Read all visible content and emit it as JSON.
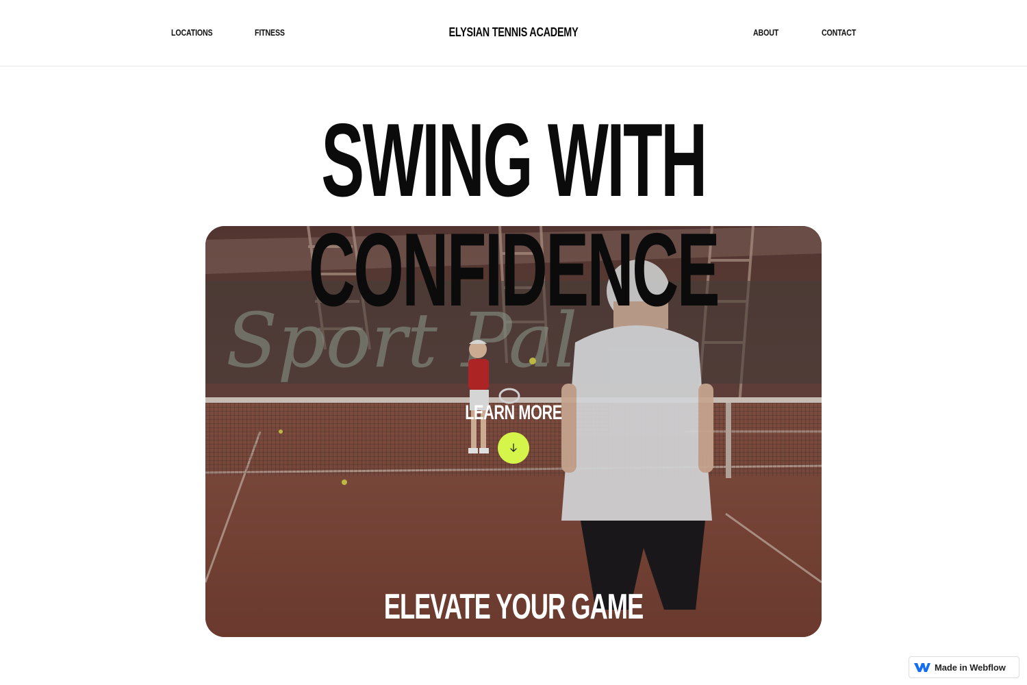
{
  "header": {
    "nav_left": [
      "LOCATIONS",
      "FITNESS"
    ],
    "brand": "ELYSIAN TENNIS ACADEMY",
    "nav_right": [
      "ABOUT",
      "CONTACT"
    ]
  },
  "hero": {
    "headline_line1": "SWING WITH",
    "headline_line2": "CONFIDENCE",
    "learn_more": "LEARN MORE",
    "scroll_icon": "arrow-down-icon",
    "tagline": "ELEVATE YOUR GAME",
    "background_scene": "clay tennis court video still",
    "background_signage": "Sport Pal",
    "accent_color": "#d6f54a"
  },
  "badge": {
    "label": "Made in Webflow",
    "icon": "webflow-logo-icon"
  }
}
